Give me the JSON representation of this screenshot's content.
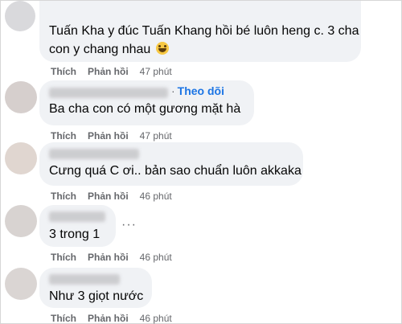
{
  "comments": [
    {
      "text_lines": [
        "Tuấn Kha y đúc Tuấn Khang hồi bé luôn heng c. 3 cha",
        "con y chang nhau"
      ],
      "has_emoji": true,
      "emoji_icon": "laughing-emoji",
      "like_label": "Thích",
      "reply_label": "Phản hồi",
      "time": "47 phút"
    },
    {
      "follow_label": "Theo dõi",
      "text_lines": [
        "Ba cha con có một gương mặt hà"
      ],
      "like_label": "Thích",
      "reply_label": "Phản hồi",
      "time": "47 phút"
    },
    {
      "text_lines": [
        "Cưng quá C ơi.. bản sao chuẩn luôn akkaka"
      ],
      "like_label": "Thích",
      "reply_label": "Phản hồi",
      "time": "46 phút"
    },
    {
      "text_lines": [
        "3 trong 1"
      ],
      "more_label": "···",
      "like_label": "Thích",
      "reply_label": "Phản hồi",
      "time": "46 phút"
    },
    {
      "text_lines": [
        "Như 3 giọt nước"
      ],
      "like_label": "Thích",
      "reply_label": "Phản hồi",
      "time": "46 phút"
    }
  ],
  "colors": {
    "bubble": "#f0f2f5",
    "link": "#1b74e4",
    "meta": "#65676b",
    "text": "#050505"
  }
}
